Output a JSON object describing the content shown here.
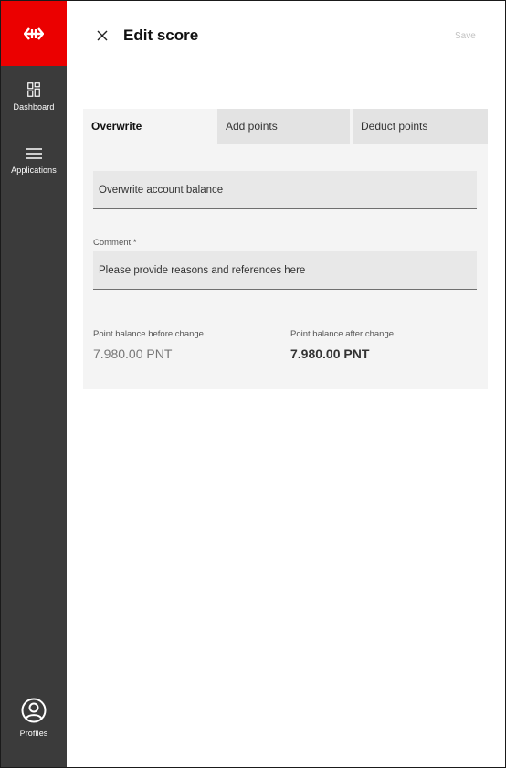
{
  "sidebar": {
    "logo_icon": "sbb-arrows-icon",
    "brand_color": "#eb0000",
    "items": [
      {
        "label": "Dashboard",
        "icon": "dashboard-grid-icon"
      },
      {
        "label": "Applications",
        "icon": "hamburger-menu-icon"
      },
      {
        "label": "Profiles",
        "icon": "user-circle-icon"
      }
    ]
  },
  "header": {
    "title": "Edit score",
    "close_icon": "close-icon",
    "save_label": "Save"
  },
  "tabs": [
    {
      "label": "Overwrite",
      "active": true
    },
    {
      "label": "Add points",
      "active": false
    },
    {
      "label": "Deduct points",
      "active": false
    }
  ],
  "form": {
    "balance_placeholder": "Overwrite account balance",
    "comment_label": "Comment *",
    "comment_placeholder": "Please provide reasons and references here"
  },
  "balance": {
    "before_label": "Point balance before change",
    "before_value": "7.980.00 PNT",
    "after_label": "Point balance after change",
    "after_value": "7.980.00 PNT"
  }
}
